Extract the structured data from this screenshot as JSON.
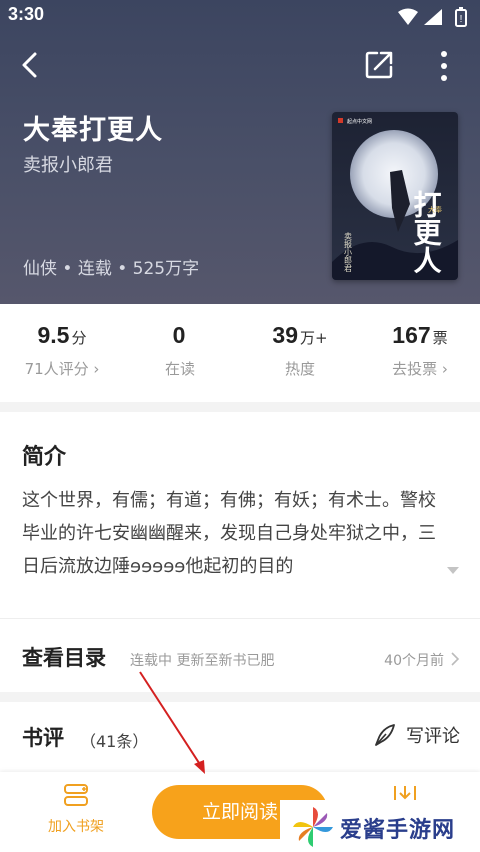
{
  "status_bar": {
    "time": "3:30"
  },
  "book": {
    "title": "大奉打更人",
    "author": "卖报小郎君",
    "meta": "仙侠 • 连载 • 525万字",
    "cover": {
      "brand": "起点中文网",
      "title_art": "打更人",
      "subtitle_art": "大奉",
      "author_art": "卖报小郎君"
    }
  },
  "stats": [
    {
      "value": "9.5",
      "unit": "分",
      "label": "71人评分 ›"
    },
    {
      "value": "0",
      "unit": "",
      "label": "在读"
    },
    {
      "value": "39",
      "unit": "万+",
      "label": "热度"
    },
    {
      "value": "167",
      "unit": "票",
      "label": "去投票 ›"
    }
  ],
  "intro": {
    "heading": "简介",
    "text": "这个世界，有儒；有道；有佛；有妖；有术士。警校毕业的许七安幽幽醒来，发现自己身处牢狱之中，三日后流放边陲ɘɘɘɘɘ他起初的目的"
  },
  "catalog": {
    "heading": "查看目录",
    "status": "连载中 更新至新书已肥",
    "updated": "40个月前"
  },
  "reviews": {
    "heading": "书评",
    "count": "（41条）",
    "write_label": "写评论"
  },
  "bottom_bar": {
    "shelf_label": "加入书架",
    "read_label": "立即阅读"
  },
  "watermark": {
    "text": "爱酱手游网"
  },
  "colors": {
    "accent": "#f7a21b",
    "header_bg": "#454c64",
    "watermark": "#2a3e8c",
    "annotation": "#d42020"
  },
  "icons": [
    "back-icon",
    "share-icon",
    "more-icon",
    "expand-icon",
    "chevron-right-icon",
    "pen-icon",
    "bookshelf-icon",
    "download-icon",
    "pinwheel-logo-icon"
  ]
}
